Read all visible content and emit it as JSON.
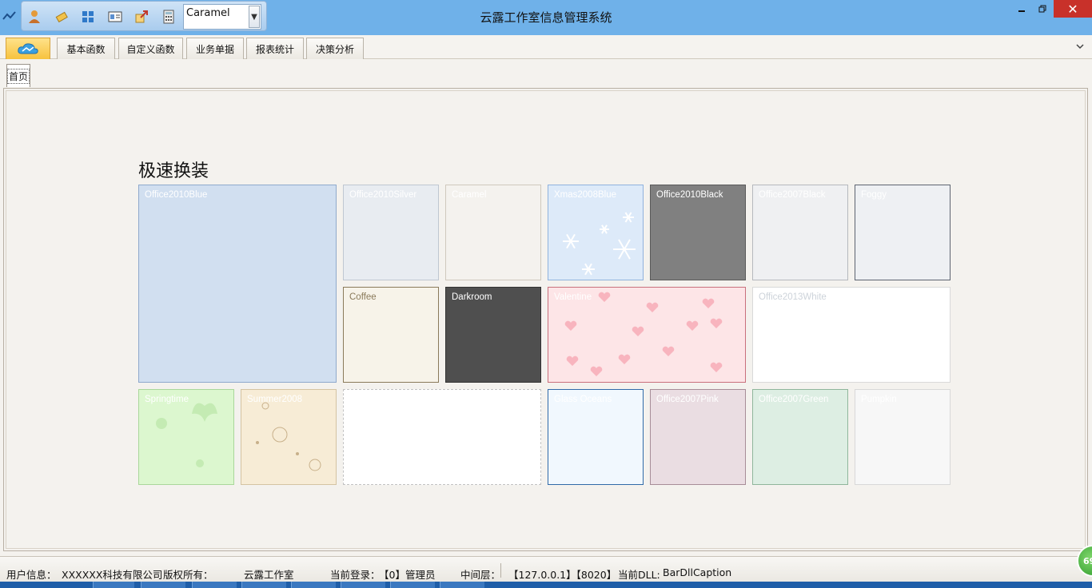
{
  "window": {
    "title": "云露工作室信息管理系统"
  },
  "quick_access": {
    "icons": [
      "user-icon",
      "eraser-icon",
      "windows-icon",
      "id-card-icon",
      "export-icon",
      "calculator-icon"
    ],
    "skin_selector_value": "Caramel"
  },
  "ribbon": {
    "tabs": [
      "基本函数",
      "自定义函数",
      "业务单据",
      "报表统计",
      "决策分析"
    ]
  },
  "document_tab": {
    "label": "首页"
  },
  "section": {
    "title": "极速换装"
  },
  "skins": [
    {
      "name": "Office2010Blue",
      "bg": "#d1dff0",
      "border": "#8fa9cc",
      "text": "#ffffff"
    },
    {
      "name": "Office2010Silver",
      "bg": "#e8ecf1",
      "border": "#bfc7d1",
      "text": "#ffffff"
    },
    {
      "name": "Caramel",
      "bg": "#f4f2ee",
      "border": "#cfc8bd",
      "text": "#ffffff"
    },
    {
      "name": "Xmas2008Blue",
      "bg": "#ddeaf9",
      "border": "#8fb2dd",
      "text": "#ffffff"
    },
    {
      "name": "Office2010Black",
      "bg": "#808080",
      "border": "#5a5a5a",
      "text": "#ffffff"
    },
    {
      "name": "Office2007Black",
      "bg": "#eff0f2",
      "border": "#b5b8bd",
      "text": "#ffffff"
    },
    {
      "name": "Foggy",
      "bg": "#eef0f3",
      "border": "#5d6470",
      "text": "#ffffff"
    },
    {
      "name": "Coffee",
      "bg": "#f7f3e9",
      "border": "#8a7a5a",
      "text": "#8a7a5a"
    },
    {
      "name": "Darkroom",
      "bg": "#4f4f4f",
      "border": "#333333",
      "text": "#ffffff"
    },
    {
      "name": "Valentine",
      "bg": "#fde5e7",
      "border": "#c9707c",
      "text": "#ffffff"
    },
    {
      "name": "Office2013White",
      "bg": "#ffffff",
      "border": "#d9d9d9",
      "text": "#cdd3da"
    },
    {
      "name": "Springtime",
      "bg": "#dcf7cf",
      "border": "#a9d79a",
      "text": "#ffffff"
    },
    {
      "name": "Summer2008",
      "bg": "#f7ecd6",
      "border": "#d4c3a2",
      "text": "#ffffff"
    },
    {
      "name": "",
      "bg": "#ffffff",
      "border": "#c2c2c2",
      "text": "#ffffff"
    },
    {
      "name": "Glass Oceans",
      "bg": "#f1f8fe",
      "border": "#2f6aa8",
      "text": "#ffffff"
    },
    {
      "name": "Office2007Pink",
      "bg": "#eadde2",
      "border": "#a78d98",
      "text": "#ffffff"
    },
    {
      "name": "Office2007Green",
      "bg": "#ddeee3",
      "border": "#8fb69b",
      "text": "#ffffff"
    },
    {
      "name": "Pumpkin",
      "bg": "#f7f7f7",
      "border": "#d8d8d8",
      "text": "#ffffff"
    }
  ],
  "status_bar": {
    "user_label": "用户信息：",
    "user_value": "XXXXXX科技有限公司",
    "copyright_label": "版权所有：",
    "copyright_value": "云露工作室",
    "login_label": "当前登录：",
    "login_value": "【0】管理员",
    "middle_label": "中间层：",
    "middle_value": "【127.0.0.1】【8020】",
    "dll_label": "当前DLL:",
    "dll_value": "BarDllCaption"
  },
  "badge": {
    "text": "69"
  }
}
